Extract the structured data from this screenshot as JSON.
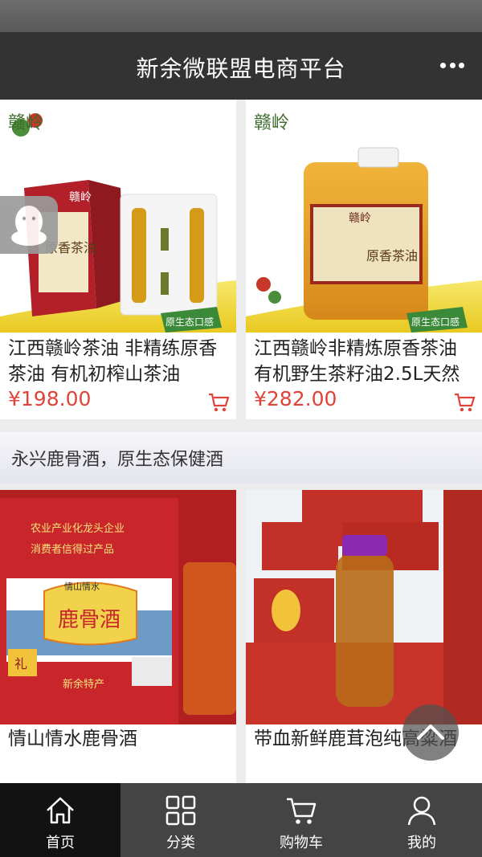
{
  "header": {
    "title": "新余微联盟电商平台",
    "menu_icon": "more-dots-icon"
  },
  "products_top": [
    {
      "name": "江西赣岭茶油 非精练原香茶油 有机初榨山茶油",
      "price": "¥198.00",
      "brand_text": "赣岭",
      "tag_text": "原香茶油",
      "badge": "原生态口感"
    },
    {
      "name": "江西赣岭非精炼原香茶油 有机野生茶籽油2.5L天然",
      "price": "¥282.00",
      "brand_text": "赣岭",
      "tag_text": "原香茶油",
      "badge": "原生态口感"
    }
  ],
  "section": {
    "title": "永兴鹿骨酒，原生态保健酒"
  },
  "products_bottom": [
    {
      "name": "情山情水鹿骨酒",
      "box_slogan_1": "农业产业化龙头企业",
      "box_slogan_2": "消费者信得过产品",
      "box_brand": "情山情水",
      "box_title": "鹿骨酒",
      "box_footer": "新余特产",
      "box_gift": "礼"
    },
    {
      "name": "带血新鲜鹿茸泡纯高粱酒"
    }
  ],
  "tabbar": [
    {
      "label": "首页",
      "icon": "home-icon"
    },
    {
      "label": "分类",
      "icon": "grid-icon"
    },
    {
      "label": "购物车",
      "icon": "cart-icon"
    },
    {
      "label": "我的",
      "icon": "user-icon"
    }
  ],
  "colors": {
    "accent_price": "#e0433a",
    "header_bg": "#333333",
    "tabbar_bg": "#444444"
  }
}
